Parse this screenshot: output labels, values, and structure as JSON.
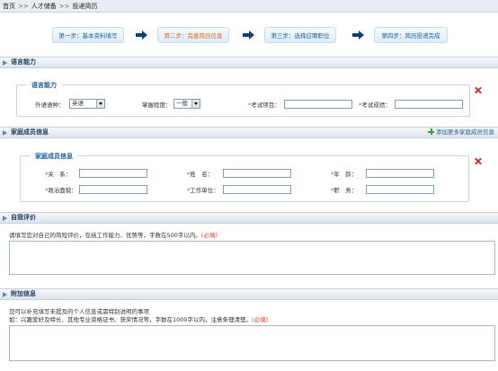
{
  "breadcrumb": {
    "home": "首页",
    "sep1": ">>",
    "talent": "人才储备",
    "sep2": ">>",
    "current": "投递简历"
  },
  "steps": [
    {
      "label": "第一步：基本资料填写"
    },
    {
      "label": "第二步：完善简历信息"
    },
    {
      "label": "第三步：选择应聘职位"
    },
    {
      "label": "第四步：简历投递完成"
    }
  ],
  "language_section": {
    "title": "语言能力",
    "legend": "语言能力",
    "lang_label": "外语语种：",
    "lang_value": "英语",
    "level_label": "掌握程度：",
    "level_value": "一般",
    "exam_label": "考试项目：",
    "score_label": "考试成绩："
  },
  "family_section": {
    "title": "家庭成员信息",
    "add_link": "添加更多家庭成员信息",
    "legend": "家庭成员信息",
    "relation_label": "关　系：",
    "name_label": "姓　名：",
    "age_label": "年　龄：",
    "politics_label": "政治面貌：",
    "work_label": "工作单位：",
    "job_label": "职　务："
  },
  "self_section": {
    "title": "自我评价",
    "hint": "请填写您对自己的简短评价，包括工作能力、优势等，字数在500字以内。",
    "required": "(必填)"
  },
  "extra_section": {
    "title": "附加信息",
    "hint1": "您可以补充填写未提及的个人信息或需特别说明的事项",
    "hint2": "如：兴趣爱好及特长、其他专业资格证书、获奖情况等，字数在1000字以内，注意条理清楚。",
    "required": "(必填)"
  },
  "required_mark": "*"
}
